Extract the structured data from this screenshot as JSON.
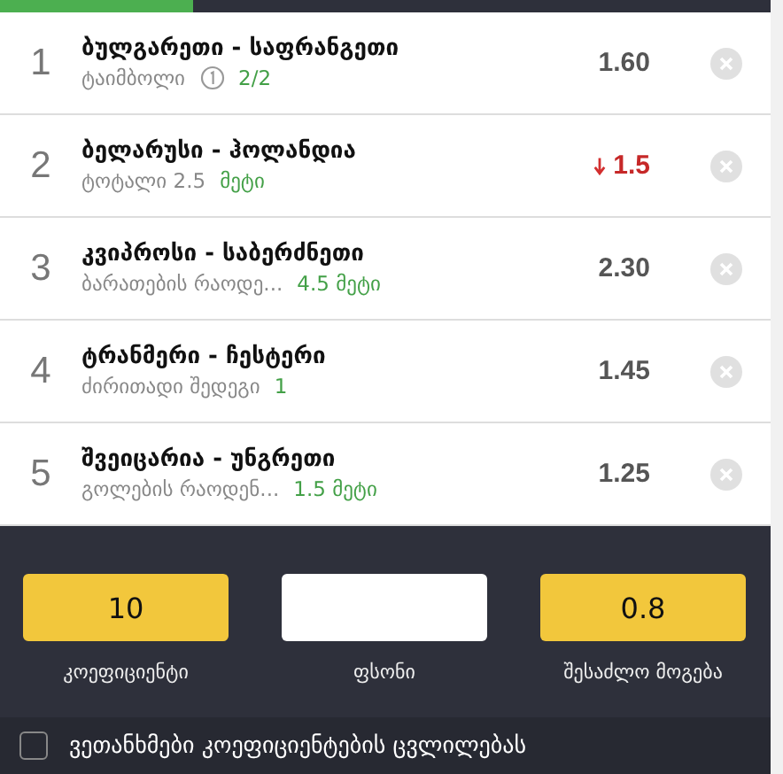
{
  "progress": {
    "level": 0.25
  },
  "bets": [
    {
      "index": "1",
      "match": "ბულგარეთი - საფრანგეთი",
      "market": "ტაიმბოლი",
      "info": true,
      "pick": "2/2",
      "odds": "1.60",
      "dropped": false
    },
    {
      "index": "2",
      "match": "ბელარუსი - ჰოლანდია",
      "market": "ტოტალი 2.5",
      "info": false,
      "pick": "მეტი",
      "odds": "1.5",
      "dropped": true
    },
    {
      "index": "3",
      "match": "კვიპროსი - საბერძნეთი",
      "market": "ბარათების რაოდე...",
      "info": false,
      "pick": "4.5 მეტი",
      "odds": "2.30",
      "dropped": false
    },
    {
      "index": "4",
      "match": "ტრანმერი - ჩესტერი",
      "market": "ძირითადი შედეგი",
      "info": false,
      "pick": "1",
      "odds": "1.45",
      "dropped": false
    },
    {
      "index": "5",
      "match": "შვეიცარია - უნგრეთი",
      "market": "გოლების რაოდენ...",
      "info": false,
      "pick": "1.5 მეტი",
      "odds": "1.25",
      "dropped": false
    }
  ],
  "summary": [
    {
      "kind": "readout",
      "value": "10",
      "label": "კოეფიციენტი"
    },
    {
      "kind": "input",
      "label": "ფსონი"
    },
    {
      "kind": "readout",
      "value": "0.8",
      "label": "შესაძლო მოგება"
    }
  ],
  "agree": {
    "label": "ვეთანხმები კოეფიციენტების ცვლილებას",
    "checked": false
  }
}
